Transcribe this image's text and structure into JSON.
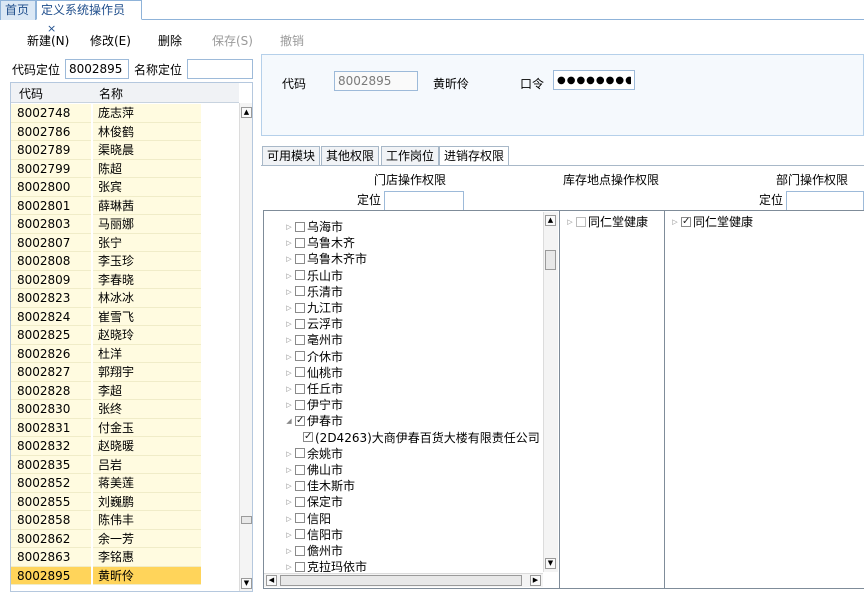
{
  "tabs": {
    "home": "首页",
    "current": "定义系统操作员",
    "close": "×"
  },
  "toolbar": {
    "new": "新建(N)",
    "edit": "修改(E)",
    "delete": "删除",
    "save": "保存(S)",
    "undo": "撤销"
  },
  "filter": {
    "code_label": "代码定位",
    "code_value": "8002895",
    "name_label": "名称定位",
    "name_value": ""
  },
  "grid": {
    "headers": [
      "代码",
      "名称"
    ],
    "rows": [
      [
        "8002748",
        "庞志萍"
      ],
      [
        "8002786",
        "林俊鹤"
      ],
      [
        "8002789",
        "渠晓晨"
      ],
      [
        "8002799",
        "陈超"
      ],
      [
        "8002800",
        "张宾"
      ],
      [
        "8002801",
        "薛琳茜"
      ],
      [
        "8002803",
        "马丽娜"
      ],
      [
        "8002807",
        "张宁"
      ],
      [
        "8002808",
        "李玉珍"
      ],
      [
        "8002809",
        "李春晓"
      ],
      [
        "8002823",
        "林冰冰"
      ],
      [
        "8002824",
        "崔雪飞"
      ],
      [
        "8002825",
        "赵晓玲"
      ],
      [
        "8002826",
        "杜洋"
      ],
      [
        "8002827",
        "郭翔宇"
      ],
      [
        "8002828",
        "李超"
      ],
      [
        "8002830",
        "张终"
      ],
      [
        "8002831",
        "付金玉"
      ],
      [
        "8002832",
        "赵晓暖"
      ],
      [
        "8002835",
        "吕岩"
      ],
      [
        "8002852",
        "蒋美莲"
      ],
      [
        "8002855",
        "刘巍鹏"
      ],
      [
        "8002858",
        "陈伟丰"
      ],
      [
        "8002862",
        "余一芳"
      ],
      [
        "8002863",
        "李铭惠"
      ],
      [
        "8002895",
        "黄昕伶"
      ]
    ],
    "selected_index": 25
  },
  "header": {
    "code_label": "代码",
    "code_value": "8002895",
    "name_value": "黄昕伶",
    "password_label": "口令",
    "password_value": "●●●●●●●●"
  },
  "subtabs": [
    "可用模块",
    "其他权限",
    "工作岗位",
    "进销存权限"
  ],
  "active_subtab": 3,
  "panels": {
    "store_title": "门店操作权限",
    "warehouse_title": "库存地点操作权限",
    "dept_title": "部门操作权限",
    "locate_label": "定位",
    "locate_label2": "定位"
  },
  "store_tree": [
    {
      "label": "乌海市",
      "checked": false,
      "expanded": false,
      "level": 0
    },
    {
      "label": "乌鲁木齐",
      "checked": false,
      "expanded": false,
      "level": 0
    },
    {
      "label": "乌鲁木齐市",
      "checked": false,
      "expanded": false,
      "level": 0
    },
    {
      "label": "乐山市",
      "checked": false,
      "expanded": false,
      "level": 0
    },
    {
      "label": "乐清市",
      "checked": false,
      "expanded": false,
      "level": 0
    },
    {
      "label": "九江市",
      "checked": false,
      "expanded": false,
      "level": 0
    },
    {
      "label": "云浮市",
      "checked": false,
      "expanded": false,
      "level": 0
    },
    {
      "label": "亳州市",
      "checked": false,
      "expanded": false,
      "level": 0
    },
    {
      "label": "介休市",
      "checked": false,
      "expanded": false,
      "level": 0
    },
    {
      "label": "仙桃市",
      "checked": false,
      "expanded": false,
      "level": 0
    },
    {
      "label": "任丘市",
      "checked": false,
      "expanded": false,
      "level": 0
    },
    {
      "label": "伊宁市",
      "checked": false,
      "expanded": false,
      "level": 0
    },
    {
      "label": "伊春市",
      "checked": true,
      "expanded": true,
      "level": 0
    },
    {
      "label": "(2D4263)大商伊春百货大楼有限责任公司",
      "checked": true,
      "expanded": null,
      "level": 1
    },
    {
      "label": "余姚市",
      "checked": false,
      "expanded": false,
      "level": 0
    },
    {
      "label": "佛山市",
      "checked": false,
      "expanded": false,
      "level": 0
    },
    {
      "label": "佳木斯市",
      "checked": false,
      "expanded": false,
      "level": 0
    },
    {
      "label": "保定市",
      "checked": false,
      "expanded": false,
      "level": 0
    },
    {
      "label": "信阳",
      "checked": false,
      "expanded": false,
      "level": 0
    },
    {
      "label": "信阳市",
      "checked": false,
      "expanded": false,
      "level": 0
    },
    {
      "label": "儋州市",
      "checked": false,
      "expanded": false,
      "level": 0
    },
    {
      "label": "克拉玛依市",
      "checked": false,
      "expanded": false,
      "level": 0
    }
  ],
  "warehouse_tree": [
    {
      "label": "同仁堂健康",
      "checked": false
    }
  ],
  "dept_tree": [
    {
      "label": "同仁堂健康",
      "checked": true
    }
  ],
  "icons": {
    "expanded": "◢",
    "collapsed": "▷",
    "up": "▲",
    "down": "▼",
    "left": "◀",
    "right": "▶"
  }
}
